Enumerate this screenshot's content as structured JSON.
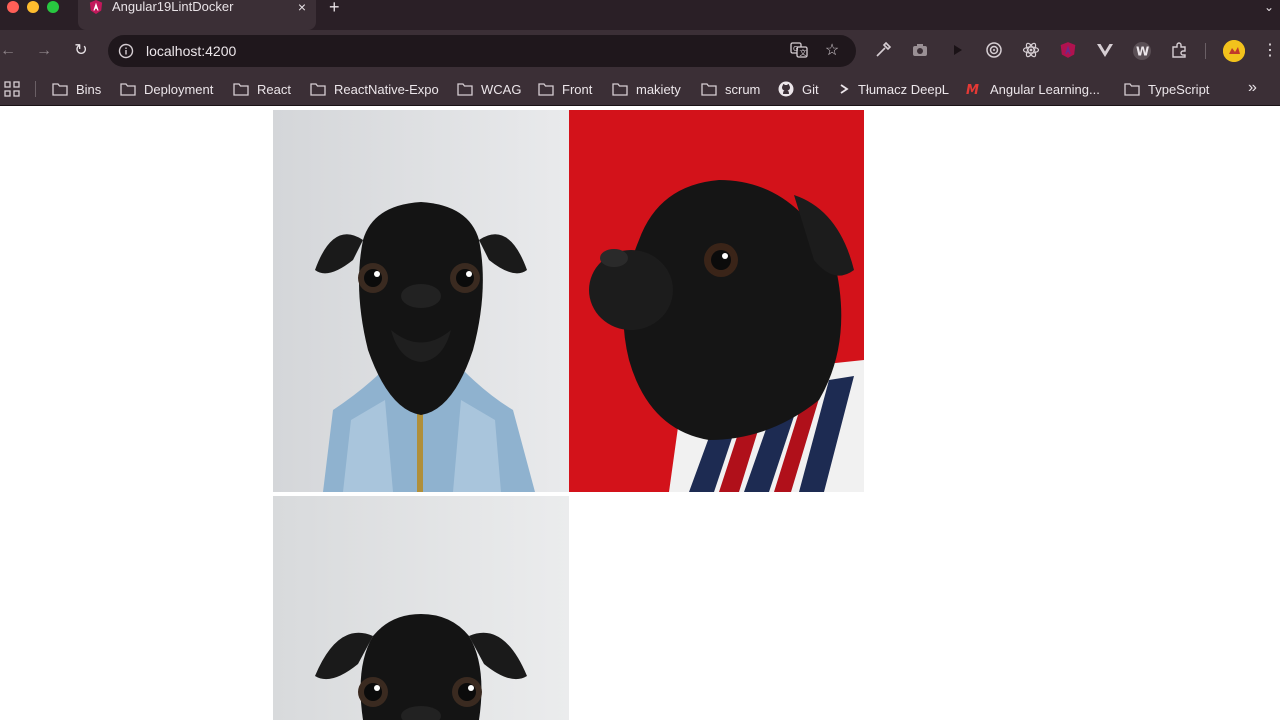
{
  "window": {
    "tab_title": "Angular19LintDocker",
    "tab_close": "×",
    "new_tab": "+",
    "tabs_menu": "⌄"
  },
  "toolbar": {
    "back": "←",
    "forward": "→",
    "reload": "↻",
    "url": "localhost:4200",
    "menu": "⋮"
  },
  "bookmarks": {
    "items": [
      {
        "label": "Bins",
        "icon": "folder-icon"
      },
      {
        "label": "Deployment",
        "icon": "folder-icon"
      },
      {
        "label": "React",
        "icon": "folder-icon"
      },
      {
        "label": "ReactNative-Expo",
        "icon": "folder-icon"
      },
      {
        "label": "WCAG",
        "icon": "folder-icon"
      },
      {
        "label": "Front",
        "icon": "folder-icon"
      },
      {
        "label": "makiety",
        "icon": "folder-icon"
      },
      {
        "label": "scrum",
        "icon": "folder-icon"
      },
      {
        "label": "Git",
        "icon": "github-icon"
      },
      {
        "label": "Tłumacz DeepL",
        "icon": "deepl-icon"
      },
      {
        "label": "Angular Learning...",
        "icon": "angular-icon"
      },
      {
        "label": "TypeScript",
        "icon": "folder-icon"
      }
    ],
    "more": "»"
  },
  "gallery": {
    "images": [
      {
        "subject": "black pug in denim jacket",
        "background": "#dfe1e3"
      },
      {
        "subject": "black pug in striped shirt",
        "background": "#d3121a"
      },
      {
        "subject": "black pug",
        "background": "#e2e4e6"
      }
    ]
  },
  "colors": {
    "chrome_bg": "#3b2f36",
    "titlebar_bg": "#2a1f26",
    "omnibox_bg": "#1f171c",
    "text": "#ece6ea"
  }
}
